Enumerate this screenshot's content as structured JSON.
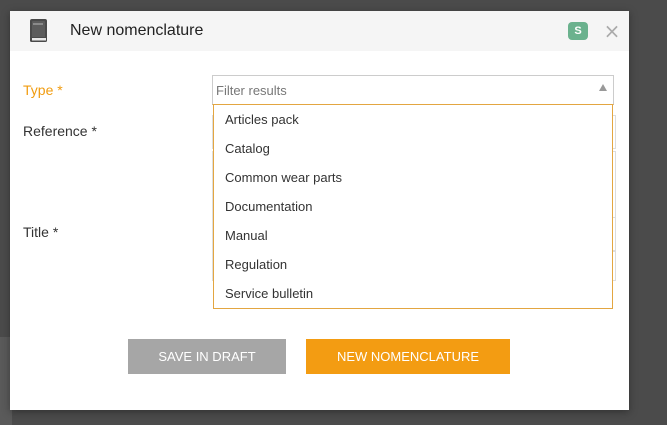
{
  "modal": {
    "title": "New nomenclature",
    "badge": "S",
    "close_symbol": "×",
    "header_icon": "book-icon"
  },
  "form": {
    "type_label": "Type *",
    "reference_label": "Reference *",
    "title_label": "Title *",
    "type_select": {
      "filter_placeholder": "Filter results",
      "options": [
        "Articles pack",
        "Catalog",
        "Common wear parts",
        "Documentation",
        "Manual",
        "Regulation",
        "Service bulletin"
      ]
    }
  },
  "buttons": {
    "save_draft": "SAVE IN DRAFT",
    "new_nomenclature": "NEW NOMENCLATURE"
  },
  "colors": {
    "accent": "#f39c12",
    "badge": "#6bb28e",
    "draft_button": "#a6a6a6",
    "active_label": "#f19c10"
  }
}
